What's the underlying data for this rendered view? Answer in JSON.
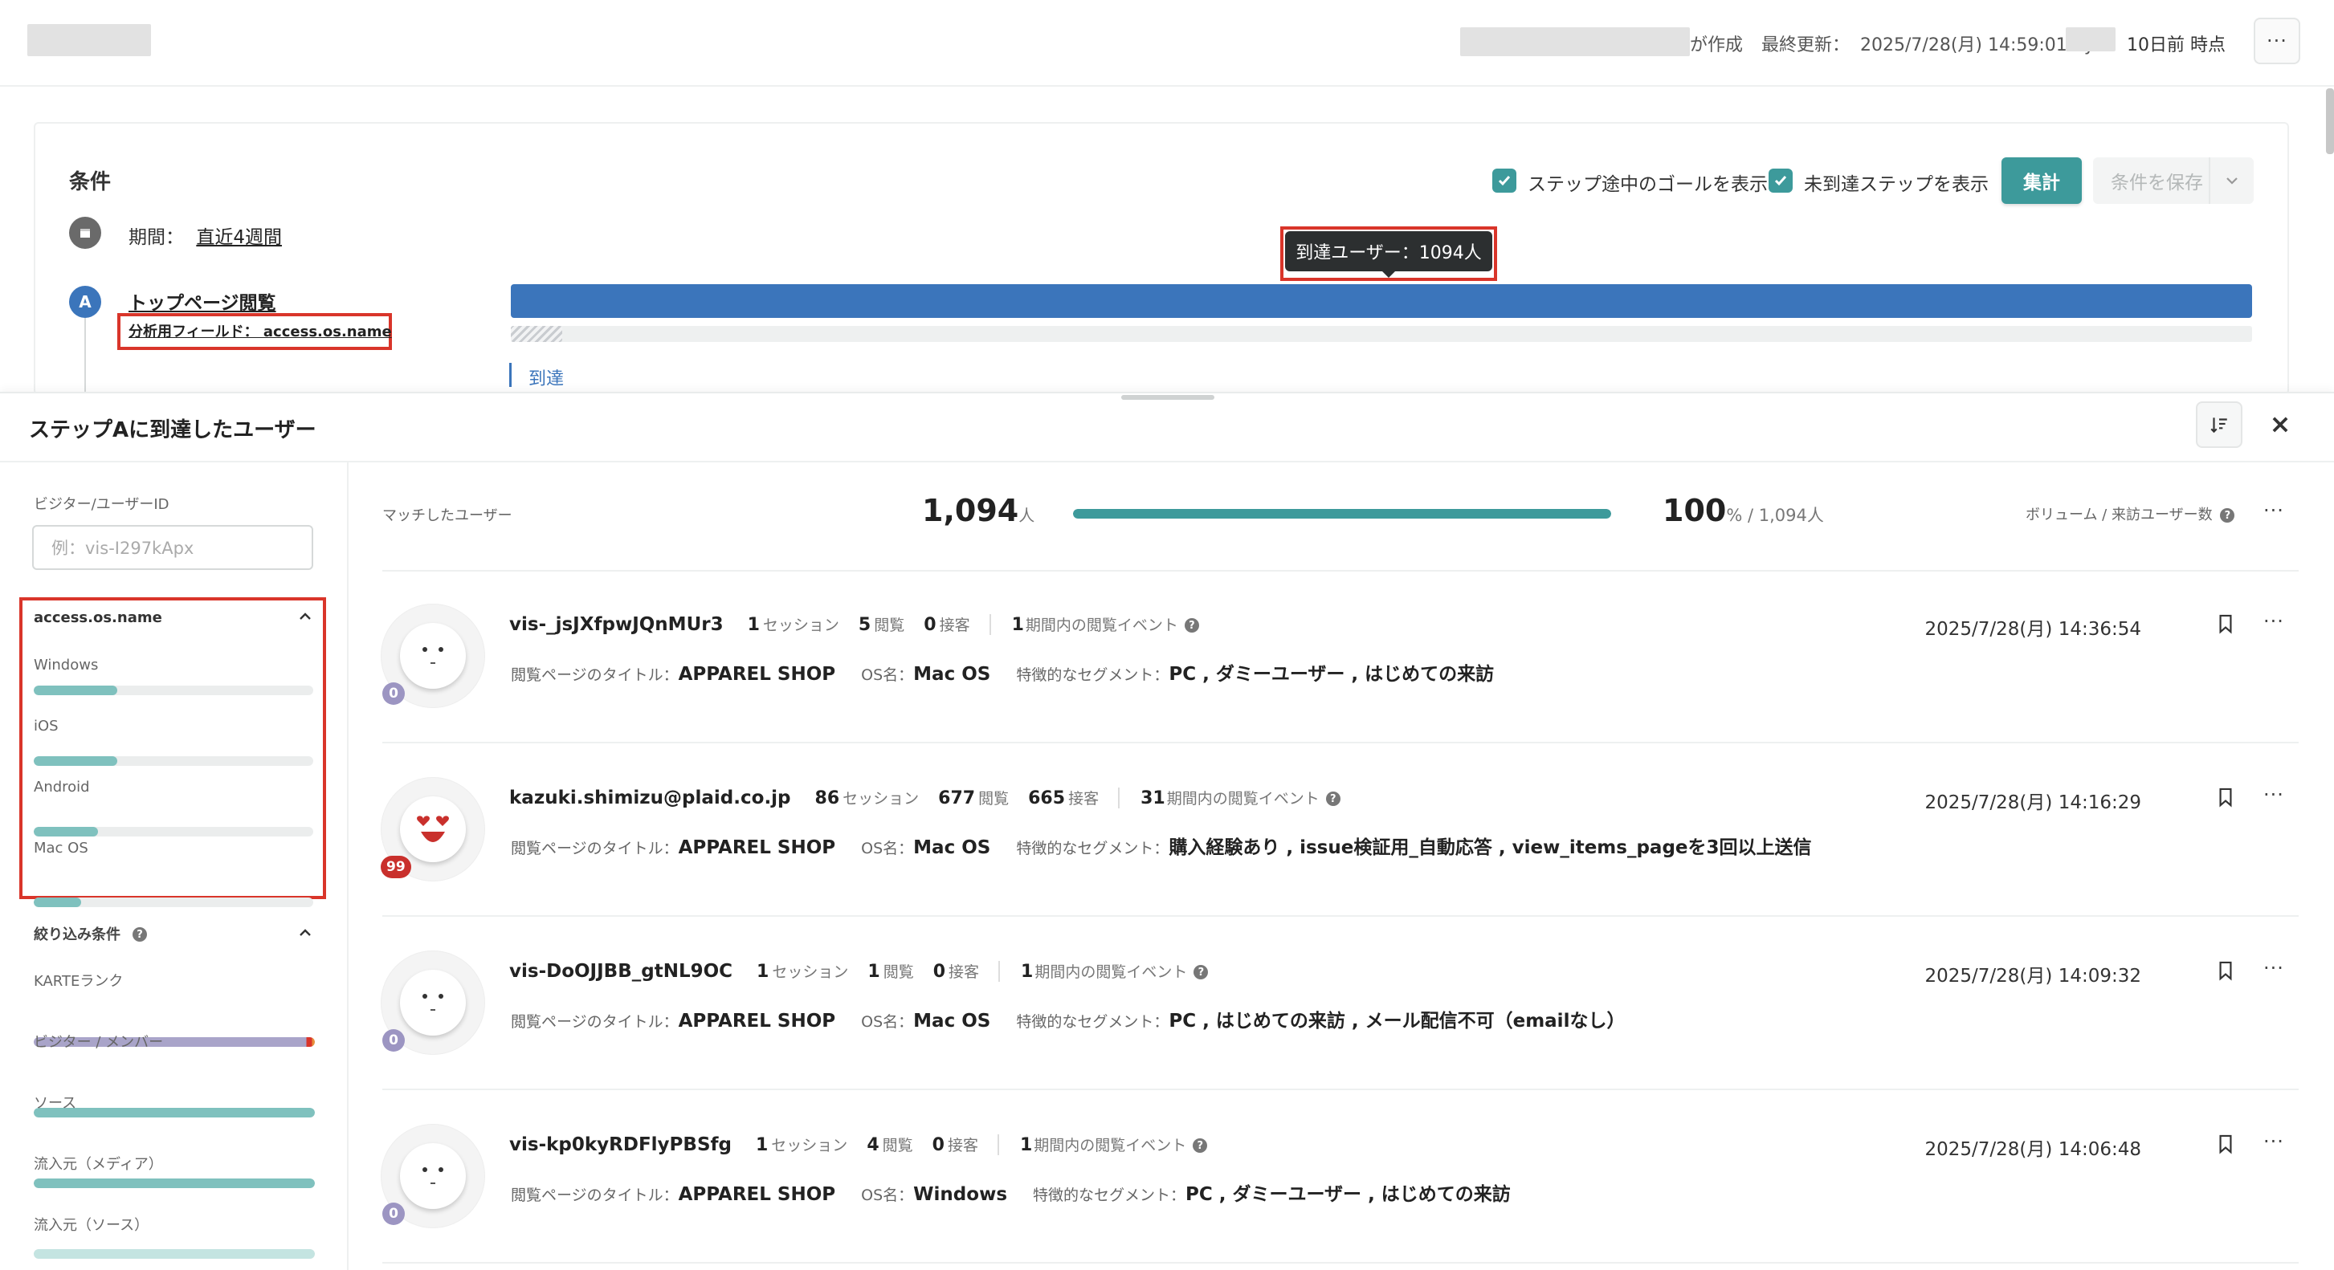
{
  "header": {
    "created_suffix": "が作成",
    "last_updated_label": "最終更新：",
    "last_updated_value": "2025/7/28(月) 14:59:01 by",
    "as_of": "10日前 時点",
    "more": "···"
  },
  "conditions": {
    "title": "条件",
    "show_goal_label": "ステップ途中のゴールを表示",
    "show_unreached_label": "未到達ステップを表示",
    "aggregate_button": "集計",
    "save_button": "条件を保存",
    "period_label": "期間：",
    "period_value": "直近4週間",
    "step_letter": "A",
    "step_name": "トップページ閲覧",
    "analysis_field": "分析用フィールド： access.os.name",
    "tooltip": "到達ユーザー：1094人",
    "reached_label": "到達",
    "reached_fraction": 1.0
  },
  "panel": {
    "title": "ステップAに到達したユーザー",
    "sort_icon": "sort-icon",
    "close": "×",
    "sidebar": {
      "visitor_id_label": "ビジター/ユーザーID",
      "visitor_id_placeholder": "例：vis-I297kApx",
      "field_section": {
        "title": "access.os.name",
        "items": [
          {
            "label": "Windows",
            "fraction": 0.3
          },
          {
            "label": "iOS",
            "fraction": 0.3
          },
          {
            "label": "Android",
            "fraction": 0.23
          },
          {
            "label": "Mac OS",
            "fraction": 0.17
          }
        ]
      },
      "filter_section": {
        "title": "絞り込み条件",
        "items": [
          {
            "label": "KARTEランク"
          },
          {
            "label": "ビジター / メンバー"
          },
          {
            "label": "ソース"
          },
          {
            "label": "流入元（メディア）"
          },
          {
            "label": "流入元（ソース）"
          }
        ]
      }
    },
    "summary": {
      "matched_label": "マッチしたユーザー",
      "matched_count": "1,094",
      "matched_unit": "人",
      "match_fraction": 1.0,
      "percent": "100",
      "percent_suffix": "% / 1,094人",
      "volume_label": "ボリューム / 来訪ユーザー数"
    },
    "users": [
      {
        "name": "vis-_jsJXfpwJQnMUr3",
        "sessions": "1",
        "sessions_unit": "セッション",
        "views": "5",
        "views_unit": "閲覧",
        "visits": "0",
        "visits_unit": "接客",
        "events": "1",
        "events_unit": "期間内の閲覧イベント",
        "page_title_label": "閲覧ページのタイトル：",
        "page_title": "APPAREL SHOP",
        "os_label": "OS名：",
        "os": "Mac OS",
        "segment_label": "特徴的なセグメント：",
        "segments": "PC , ダミーユーザー , はじめての来訪",
        "timestamp": "2025/7/28(月) 14:36:54",
        "rank": "0",
        "face": "neutral"
      },
      {
        "name": "kazuki.shimizu@plaid.co.jp",
        "sessions": "86",
        "sessions_unit": "セッション",
        "views": "677",
        "views_unit": "閲覧",
        "visits": "665",
        "visits_unit": "接客",
        "events": "31",
        "events_unit": "期間内の閲覧イベント",
        "page_title_label": "閲覧ページのタイトル：",
        "page_title": "APPAREL SHOP",
        "os_label": "OS名：",
        "os": "Mac OS",
        "segment_label": "特徴的なセグメント：",
        "segments": "購入経験あり , issue検証用_自動応答 , view_items_pageを3回以上送信",
        "timestamp": "2025/7/28(月) 14:16:29",
        "rank": "99",
        "face": "love"
      },
      {
        "name": "vis-DoOJJBB_gtNL9OC",
        "sessions": "1",
        "sessions_unit": "セッション",
        "views": "1",
        "views_unit": "閲覧",
        "visits": "0",
        "visits_unit": "接客",
        "events": "1",
        "events_unit": "期間内の閲覧イベント",
        "page_title_label": "閲覧ページのタイトル：",
        "page_title": "APPAREL SHOP",
        "os_label": "OS名：",
        "os": "Mac OS",
        "segment_label": "特徴的なセグメント：",
        "segments": "PC , はじめての来訪 , メール配信不可（emailなし）",
        "timestamp": "2025/7/28(月) 14:09:32",
        "rank": "0",
        "face": "neutral"
      },
      {
        "name": "vis-kp0kyRDFlyPBSfg",
        "sessions": "1",
        "sessions_unit": "セッション",
        "views": "4",
        "views_unit": "閲覧",
        "visits": "0",
        "visits_unit": "接客",
        "events": "1",
        "events_unit": "期間内の閲覧イベント",
        "page_title_label": "閲覧ページのタイトル：",
        "page_title": "APPAREL SHOP",
        "os_label": "OS名：",
        "os": "Windows",
        "segment_label": "特徴的なセグメント：",
        "segments": "PC , ダミーユーザー , はじめての来訪",
        "timestamp": "2025/7/28(月) 14:06:48",
        "rank": "0",
        "face": "neutral"
      }
    ]
  },
  "colors": {
    "teal": "#3d9a9b",
    "blue": "#3b75bb",
    "red": "#d9352a",
    "rank_zero": "#9c95c2",
    "rank_high": "#c9302c"
  }
}
